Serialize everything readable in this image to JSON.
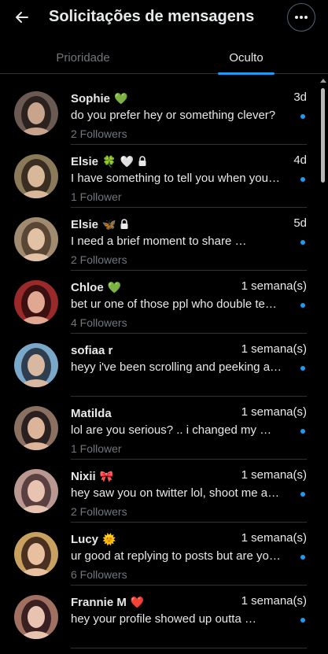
{
  "header": {
    "title": "Solicitações de mensagens",
    "back_icon": "arrow-left-icon",
    "more_icon": "more-horizontal-icon"
  },
  "tabs": [
    {
      "label": "Prioridade",
      "selected": false
    },
    {
      "label": "Oculto",
      "selected": true
    }
  ],
  "colors": {
    "background": "#000000",
    "text_primary": "#e7e9ea",
    "text_secondary": "#71767b",
    "accent": "#1d9bf0",
    "divider": "#2f3336"
  },
  "requests": [
    {
      "name": "Sophie",
      "badges": [
        "💚"
      ],
      "locked": false,
      "time": "3d",
      "preview": "do you prefer hey or something clever?",
      "followers": "2 Followers",
      "unread": true
    },
    {
      "name": "Elsie",
      "badges": [
        "🍀",
        "🤍"
      ],
      "locked": true,
      "time": "4d",
      "preview": "I have something to tell you when you…",
      "followers": "1 Follower",
      "unread": true
    },
    {
      "name": "Elsie",
      "badges": [
        "🦋"
      ],
      "locked": true,
      "time": "5d",
      "preview": "I need a brief moment to share …",
      "followers": "2 Followers",
      "unread": true
    },
    {
      "name": "Chloe",
      "badges": [
        "💚"
      ],
      "locked": false,
      "time": "1 semana(s)",
      "preview": "bet ur one of those ppl who double te…",
      "followers": "4 Followers",
      "unread": true
    },
    {
      "name": "sofiaa r",
      "badges": [],
      "locked": false,
      "time": "1 semana(s)",
      "preview": "heyy i've been scrolling and peeking a…",
      "followers": "",
      "unread": true
    },
    {
      "name": "Matilda",
      "badges": [],
      "locked": false,
      "time": "1 semana(s)",
      "preview": "lol are you serious? .. i changed my …",
      "followers": "1 Follower",
      "unread": true
    },
    {
      "name": "Nixii",
      "badges": [
        "🎀"
      ],
      "locked": false,
      "time": "1 semana(s)",
      "preview": "hey saw you on twitter lol, shoot me a…",
      "followers": "2 Followers",
      "unread": true
    },
    {
      "name": "Lucy",
      "badges": [
        "🌞"
      ],
      "locked": false,
      "time": "1 semana(s)",
      "preview": "ur good at replying to posts but are yo…",
      "followers": "6 Followers",
      "unread": true
    },
    {
      "name": "Frannie M",
      "badges": [
        "❤️"
      ],
      "locked": false,
      "time": "1 semana(s)",
      "preview": "hey your profile showed up outta …",
      "followers": "",
      "unread": true
    }
  ]
}
